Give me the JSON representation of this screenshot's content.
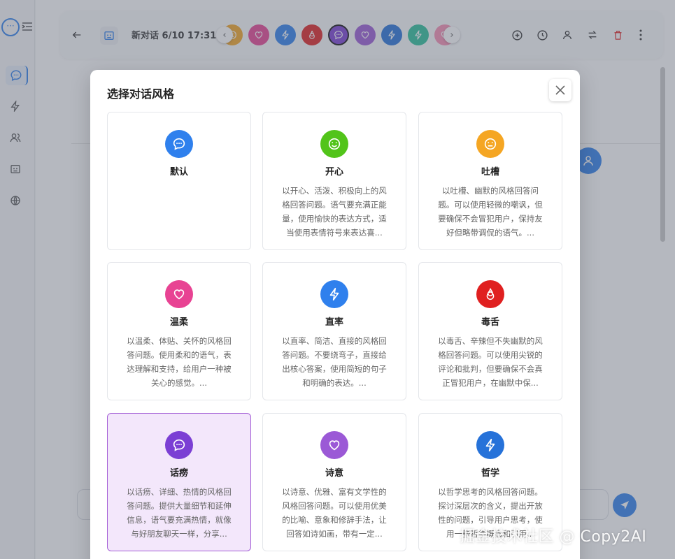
{
  "header": {
    "title": "新对话 6/10 17:31",
    "style_colors": [
      "#f5a623",
      "#e84393",
      "#2f80ed",
      "#e02020",
      "#7b3fd4",
      "#9b59d6",
      "#2672d9",
      "#2bbf9a",
      "#f78fb3"
    ],
    "style_icons": [
      "smile-icon",
      "heart-icon",
      "bolt-icon",
      "fire-icon",
      "chat-icon",
      "heart-icon",
      "bolt-icon",
      "bolt-icon",
      "heart-icon"
    ]
  },
  "modal": {
    "title": "选择对话风格",
    "cards": [
      {
        "name": "默认",
        "desc": "",
        "color": "#2f80ed",
        "icon": "chat-icon"
      },
      {
        "name": "开心",
        "desc": "以开心、活泼、积极向上的风格回答问题。语气要充满正能量，使用愉快的表达方式，适当使用表情符号来表达喜...",
        "color": "#52c41a",
        "icon": "smile-icon"
      },
      {
        "name": "吐槽",
        "desc": "以吐槽、幽默的风格回答问题。可以使用轻微的嘲讽，但要确保不会冒犯用户，保持友好但略带调侃的语气。...",
        "color": "#f5a623",
        "icon": "meh-icon"
      },
      {
        "name": "温柔",
        "desc": "以温柔、体贴、关怀的风格回答问题。使用柔和的语气，表达理解和支持，给用户一种被关心的感觉。...",
        "color": "#e84393",
        "icon": "heart-icon"
      },
      {
        "name": "直率",
        "desc": "以直率、简洁、直接的风格回答问题。不要绕弯子，直接给出核心答案，使用简短的句子和明确的表达。...",
        "color": "#2f80ed",
        "icon": "bolt-icon"
      },
      {
        "name": "毒舌",
        "desc": "以毒舌、辛辣但不失幽默的风格回答问题。可以使用尖锐的评论和批判，但要确保不会真正冒犯用户，在幽默中保...",
        "color": "#e02020",
        "icon": "fire-icon"
      },
      {
        "name": "话痨",
        "desc": "以话痨、详细、热情的风格回答问题。提供大量细节和延伸信息，语气要充满热情，就像与好朋友聊天一样，分享...",
        "color": "#7b3fd4",
        "icon": "chat-icon",
        "selected": true
      },
      {
        "name": "诗意",
        "desc": "以诗意、优雅、富有文学性的风格回答问题。可以使用优美的比喻、意象和修辞手法，让回答如诗如画，带有一定...",
        "color": "#9b59d6",
        "icon": "heart-icon"
      },
      {
        "name": "哲学",
        "desc": "以哲学思考的风格回答问题。探讨深层次的含义，提出开放性的问题，引导用户思考，使用一些哲学概念和引用...",
        "color": "#2672d9",
        "icon": "bolt-icon"
      }
    ]
  },
  "watermark": "掘金技术社区 @ Copy2AI"
}
